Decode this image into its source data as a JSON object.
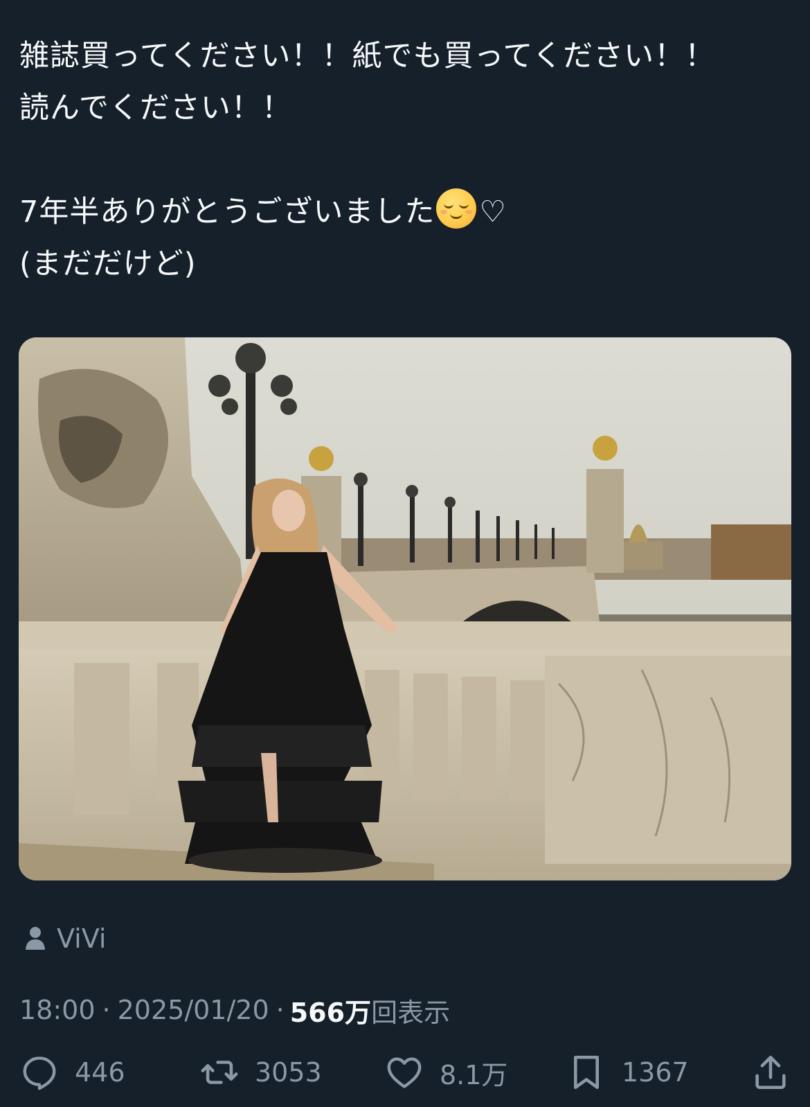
{
  "tweet": {
    "lines": [
      "雑誌買ってください！！紙でも買ってください！！",
      "読んでください！！",
      "7年半ありがとうございました",
      "(まだだけど)"
    ],
    "heart": "♡"
  },
  "photo": {
    "description_icon": "photo-image"
  },
  "tagged": {
    "icon": "person-icon",
    "name": "ViVi"
  },
  "meta": {
    "time": "18:00",
    "separator": "·",
    "date": "2025/01/20",
    "views_count": "566万",
    "views_label": "回表示"
  },
  "actions": {
    "replies": "446",
    "reposts": "3053",
    "likes": "8.1万",
    "bookmarks": "1367"
  },
  "colors": {
    "background": "#15202b",
    "secondary_text": "#8b98a5",
    "primary_text": "#f7f9f9"
  }
}
